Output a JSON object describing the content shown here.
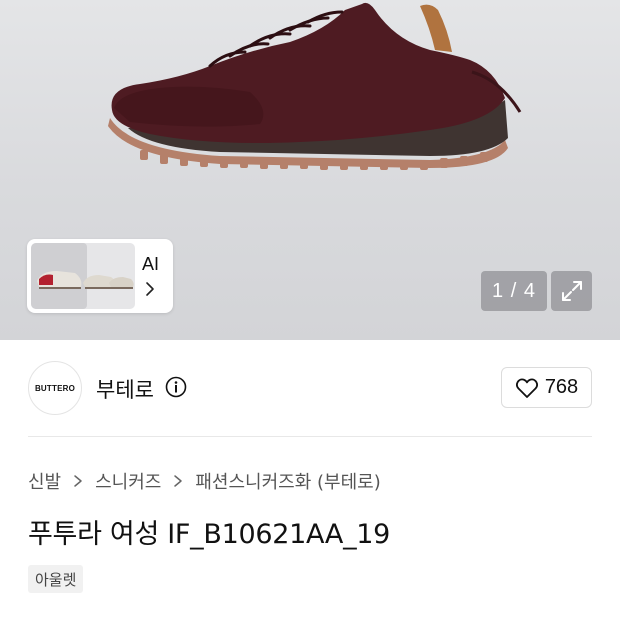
{
  "gallery": {
    "ai_label": "AI",
    "page_counter": "1 / 4"
  },
  "brand": {
    "logo_text": "BUTTERO",
    "name": "부테로",
    "like_count": "768"
  },
  "breadcrumb": [
    "신발",
    "스니커즈",
    "패션스니커즈화 (부테로)"
  ],
  "product": {
    "title": "푸투라 여성 IF_B10621AA_19",
    "tag": "아울렛"
  },
  "colors": {
    "shoe_upper": "#4e1b22",
    "shoe_sole": "#3f3431",
    "shoe_outsole": "#b5806a",
    "counter_bg": "#7d7d82"
  }
}
